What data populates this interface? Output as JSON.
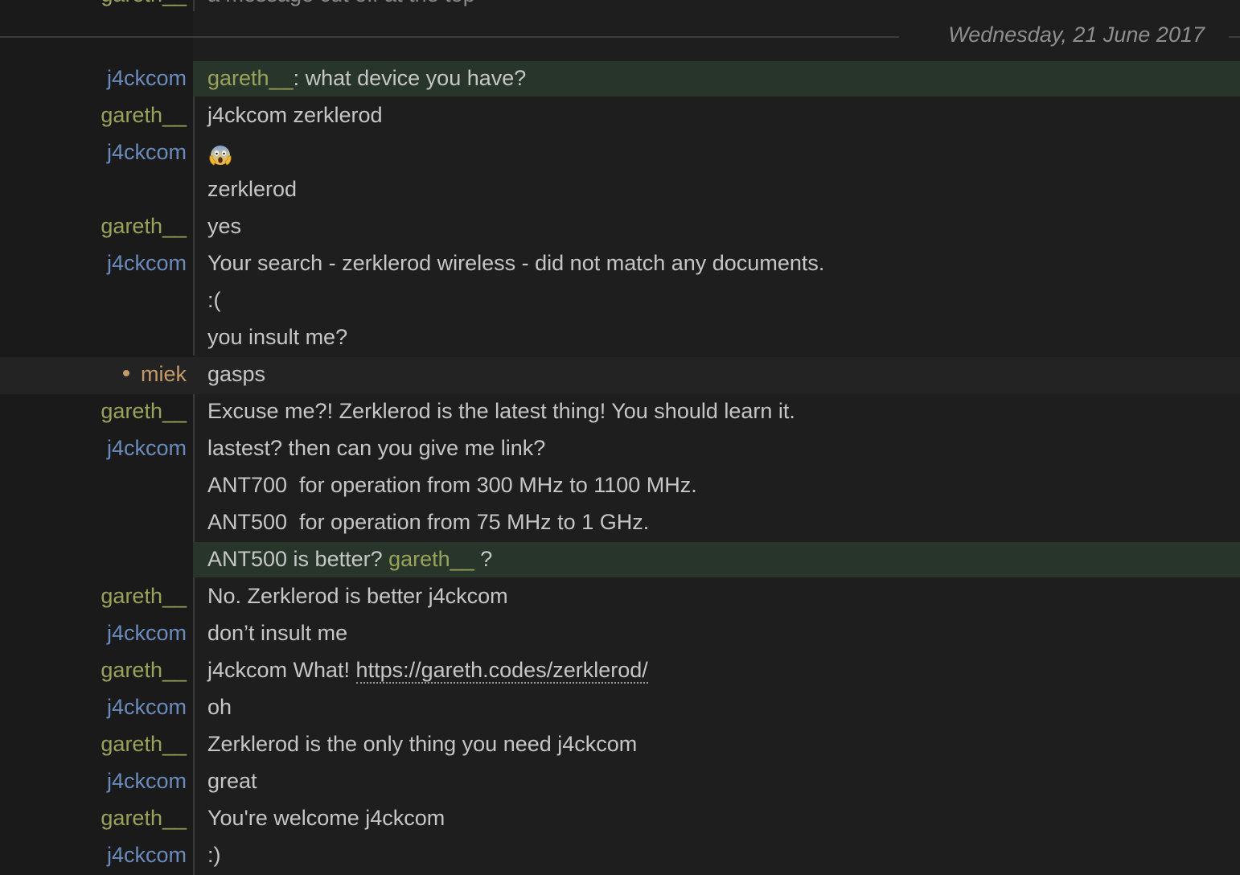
{
  "top_clip": {
    "nick": "gareth__",
    "text": "a message cut off at the top"
  },
  "date_separator": "Wednesday, 21 June 2017",
  "colors": {
    "background": "#1e1e1e",
    "nick_j4ckcom": "#6b8bbd",
    "nick_gareth": "#9aa35a",
    "nick_miek": "#c39a68",
    "highlight": "#28352b",
    "text": "#c6c6c6"
  },
  "messages": [
    {
      "nick": "j4ckcom",
      "mention": "gareth__",
      "text": ": what device you have?"
    },
    {
      "nick": "gareth__",
      "text": "j4ckcom zerklerod"
    },
    {
      "nick": "j4ckcom",
      "text": "",
      "icon": "face-screaming-in-fear-emoji"
    },
    {
      "nick": "",
      "text": "zerklerod"
    },
    {
      "nick": "gareth__",
      "text": "yes"
    },
    {
      "nick": "j4ckcom",
      "text": "Your search - zerklerod wireless - did not match any documents."
    },
    {
      "nick": "",
      "text": ":("
    },
    {
      "nick": "",
      "text": "you insult me?"
    },
    {
      "nick": "miek",
      "text": "gasps",
      "action": true
    },
    {
      "nick": "gareth__",
      "text": "Excuse me?! Zerklerod is the latest thing! You should learn it."
    },
    {
      "nick": "j4ckcom",
      "text": "lastest? then can you give me link?"
    },
    {
      "nick": "",
      "text": "ANT700  for operation from 300 MHz to 1100 MHz."
    },
    {
      "nick": "",
      "text": "ANT500  for operation from 75 MHz to 1 GHz."
    },
    {
      "nick": "",
      "text": "ANT500 is better? ",
      "mention": "gareth__",
      "suffix": " ?"
    },
    {
      "nick": "gareth__",
      "text": "No. Zerklerod is better j4ckcom"
    },
    {
      "nick": "j4ckcom",
      "text": "don’t insult me"
    },
    {
      "nick": "gareth__",
      "text": "j4ckcom What! ",
      "link": "https://gareth.codes/zerklerod/"
    },
    {
      "nick": "j4ckcom",
      "text": "oh"
    },
    {
      "nick": "gareth__",
      "text": "Zerklerod is the only thing you need j4ckcom"
    },
    {
      "nick": "j4ckcom",
      "text": "great"
    },
    {
      "nick": "gareth__",
      "text": "You're welcome j4ckcom"
    },
    {
      "nick": "j4ckcom",
      "text": ":)"
    }
  ]
}
